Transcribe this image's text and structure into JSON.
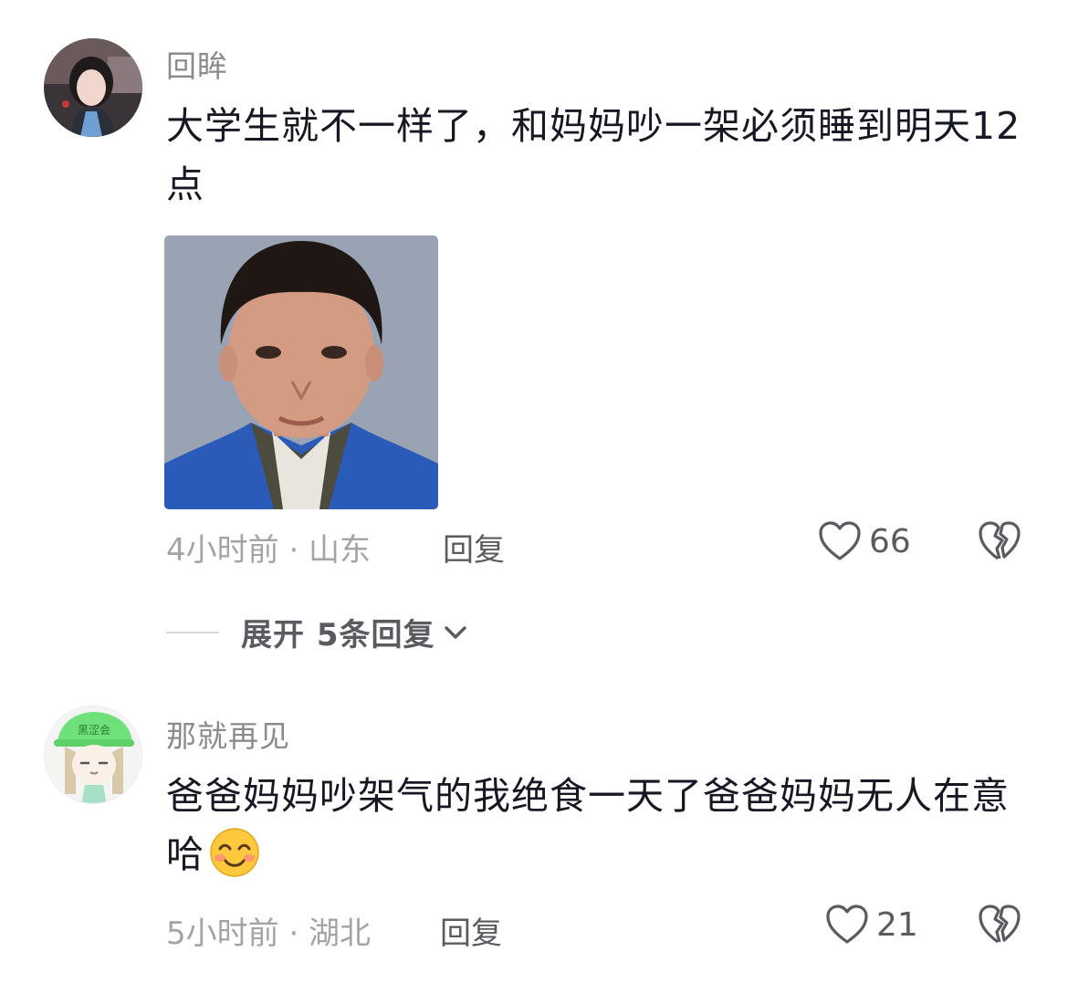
{
  "comments": [
    {
      "username": "回眸",
      "text": "大学生就不一样了，和妈妈吵一架必须睡到明天12点",
      "meta": "4小时前 · 山东",
      "reply_label": "回复",
      "likes": "66",
      "has_image": true,
      "expand_label": "展开 5条回复"
    },
    {
      "username": "那就再见",
      "text": "爸爸妈妈吵架气的我绝食一天了爸爸妈妈无人在意哈",
      "meta": "5小时前 · 湖北",
      "reply_label": "回复",
      "likes": "21",
      "emoji": "smiling-face-emoji",
      "avatar_badge": "黑涩会"
    }
  ],
  "colors": {
    "username": "#8a8b91",
    "text": "#161823",
    "meta": "#a3a4aa",
    "action": "#5a5b61"
  }
}
